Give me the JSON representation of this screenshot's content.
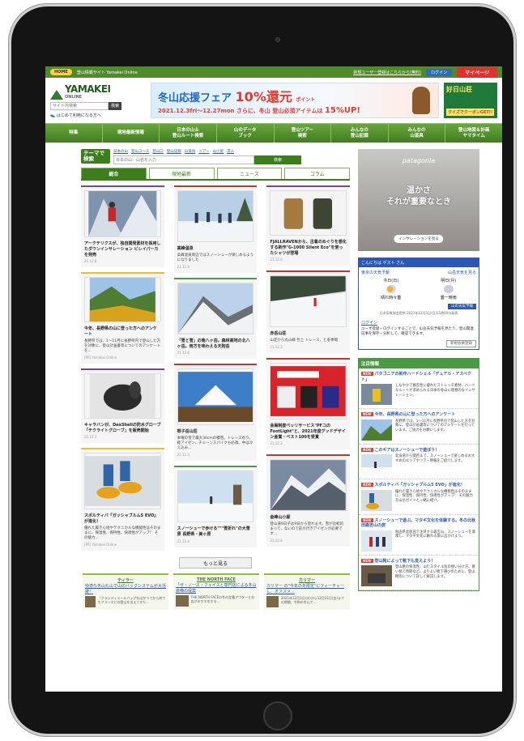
{
  "topbar": {
    "home": "HOME",
    "site_info": "登山情報サイト Yamakei Online",
    "new_user": "新規ユーザー登録はこちらから(無料)",
    "login": "ログイン",
    "mypage": "マイページ"
  },
  "header": {
    "logo_text": "YAMAKEI",
    "logo_sub": "ONLINE",
    "search_placeholder": "サイト内検索",
    "search_btn": "検索",
    "first_time": "はじめて利用になる方へ",
    "banner_title": "冬山応援フェア",
    "banner_pct": "10%還元",
    "banner_point": "ポイント",
    "banner_dates": "2021.12.3fri～12.27mon",
    "banner_sub": "さらに、冬山 登山必須アイテムは",
    "banner_pct2": "15%UP!",
    "side_banner_title": "好日山荘",
    "side_banner_sub": "クイズでクーポンGET!!"
  },
  "gnav": [
    "特集",
    "現地最新情報",
    "日本の山＆\n登山ルート検索",
    "山のデータ\nブック",
    "登山ツアー\n検索",
    "みんなの\n登山記録",
    "みんなの\n山道具",
    "登山地図＆計画\nヤマタイム"
  ],
  "theme_search": {
    "label": "テーマで検索",
    "links": [
      "日本の山",
      "登山コース",
      "登山口",
      "登山記録",
      "山道具",
      "ツアー",
      "山小屋",
      "求人"
    ],
    "placeholder": "日本の山：山名を入力",
    "button": "検索"
  },
  "tabs": [
    "総合",
    "現地最新",
    "ニュース",
    "コラム"
  ],
  "col1": [
    {
      "title": "アークテリクスが、独自開発素材を採用したダウンインサレーション ビレイパーカを発売",
      "desc": "",
      "meta": "21.12.8"
    },
    {
      "title": "今年、長野県の山に登った方へのアンケート",
      "desc": "長野県では、1～11月に長野県内で登山した方を対象に、登山計画書等についてのアンケートを...",
      "meta": "[PR] Yamakei Online"
    },
    {
      "title": "キャラバンが、DexShellの防水グローブ「テクライトグローブ」を販売開始",
      "desc": "",
      "meta": "21.12.3"
    },
    {
      "title": "スポルティバ『ガッシャブルム5 EVO』が進化！",
      "desc": "優れた履き心地やテクニカルな機能性はそのままに、保温性、保持性、快適性がアップ！ その魅力...",
      "meta": "[PR] Yamakei Online"
    }
  ],
  "col2": [
    {
      "title": "高峰温泉",
      "desc": "高峰温泉周辺ではスノーシューが楽しめるようになりました",
      "meta": "21.12.8"
    },
    {
      "title": "「雪と雪」の南八ヶ岳。森林高地の北八ヶ岳。両方を味わえる天狗岳",
      "desc": "",
      "meta": "21.12.6"
    },
    {
      "title": "根子岳山荘",
      "desc": "本曜の雪で最大30cmの積雪。トレース有り。軽アイゼン、チェーンスパイクも必須。中は冷え込み...",
      "meta": "21.12.3"
    },
    {
      "title": "スノーシューで歩ける\"\"\"雪折れ\"の大雪原 長野県・美ヶ原",
      "desc": "",
      "meta": "21.12.4"
    }
  ],
  "col3": [
    {
      "title": "FJALLRAVENから、古着のめぐりを感化する新作\"G-1000 Silent Eco\"を使ったシャツが登場",
      "desc": "",
      "meta": "21.12.6"
    },
    {
      "title": "赤岳山荘",
      "desc": "山荘から丸山峰 竹上 トレース、と冬季場",
      "meta": "21.12.3"
    },
    {
      "title": "会員制度ベッリサービス\"PFコのFootLight\"と、2021年度グッドデザイン金賞・ベスト100を受賞",
      "desc": "",
      "meta": "21.12.3"
    },
    {
      "title": "金峰山小屋",
      "desc": "登山道9日子は9日から登れます。雪が比較的まって、ないので前爪付きアイゼンが必要です...",
      "meta": "21.12.8"
    }
  ],
  "more_btn": "もっと見る",
  "promos": [
    {
      "head": "ティラー",
      "title": "快適な冬山も山で山のバッグシステムが大活躍！",
      "text": "「クラシティラールバッグ社はかつてから何でもフランスとの登山を支えてきた..."
    },
    {
      "head": "THE NORTH FACE",
      "title": "「ザ・ノース・フェイスと専門店による冬山装備の提案",
      "text": "THE NORTH FACEの冬の定番アウターとお店がおすすめする..."
    },
    {
      "head": "カリマー",
      "title": "カリマー の\"今年の冬限定\"にフィーチャーし、オススメ...",
      "text": "2021年12月1日(水)から12月31日(金)までの期間、令和の冬山で..."
    }
  ],
  "ad": {
    "brand": "patagonia",
    "copy": "温かさ\nそれが重要なとき",
    "button": "インサレーションを見る"
  },
  "weather": {
    "greeting": "こんにちは ゲスト さん",
    "location": "東京の天気予報",
    "change": "山岳天気を見る",
    "today_label": "今日(日)",
    "today_text": "晴れ時々曇",
    "tomorrow_label": "明日(月)",
    "tomorrow_text": "曇一時雨",
    "btn": "山の天気予報",
    "note": "日本気象協会提供:2021年12月5日(日)11時00分発表",
    "login_title": "ログイン",
    "login_text": "ユーザ登録・ログインすることで、山岳天気予報を見たり、登山関連記事を保存・分析して、確認できます。",
    "more": "新規会員登録"
  },
  "pickup": {
    "head": "注目情報",
    "items": [
      {
        "title": "パタゴニアの新作ハードシェル「デュアル・アスペクト」",
        "text": "しなやかで静音性に優れたストレッチ素材、ハードなルートが求められる日本の冬山に理想的なインサレーション。"
      },
      {
        "title": "今年、長野県の山に登った方へのアンケート",
        "text": "長野県では、1～11月に長野県内で登山した方を対象に、登山計画書等についてのアンケートを行っています。ご協力をお願いします。"
      },
      {
        "title": "このギアはスノーシューで遊ぼう！",
        "text": "北海道から関西まで、スノーシューで楽しめるおすすめのエリアやツアー情報をご紹介します。"
      },
      {
        "title": "スポルティバ「ガッシャブルム5 EVO」が進化！",
        "text": "優れた履き心地やテクニカルな機能性はそのままに、保温性、保持性、快適性がアップ！ その魅力を山岳ガイドと一緒に紹介。"
      },
      {
        "title": "スノーシューで遊ぶ。マタギ文化を体験する。冬の北秋田森吉山の旅",
        "text": "秋田県北秋田で注目する森吉山、スノーシューを満喫し、マタギ文化に触れる旅に出かけよう。"
      },
      {
        "title": "登山靴によって靴下も変えよう！",
        "text": "登山靴の保温性、山行スタイル別の使い分け方、買い替え時期など、よりよい靴下選びのために、登山靴別について詳しく解説します。"
      }
    ]
  }
}
